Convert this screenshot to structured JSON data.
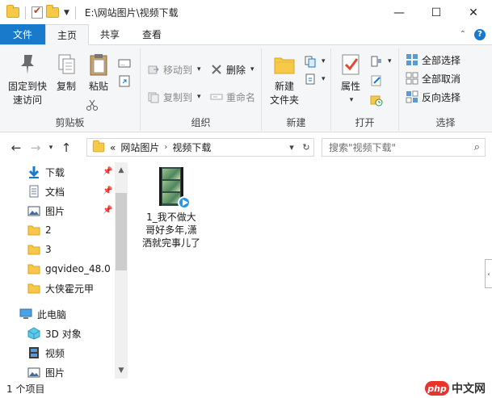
{
  "window": {
    "title": "E:\\网站图片\\视频下载",
    "buttons": {
      "minimize": "—",
      "maximize": "☐",
      "close": "✕"
    }
  },
  "ribbon_tabs": [
    {
      "label": "文件"
    },
    {
      "label": "主页"
    },
    {
      "label": "共享"
    },
    {
      "label": "查看"
    }
  ],
  "ribbon": {
    "clipboard": {
      "group_label": "剪贴板",
      "pin_label_line1": "固定到快",
      "pin_label_line2": "速访问",
      "copy_label": "复制",
      "paste_label": "粘贴"
    },
    "organize": {
      "group_label": "组织",
      "move_to": "移动到",
      "copy_to": "复制到",
      "delete": "删除",
      "rename": "重命名"
    },
    "new": {
      "group_label": "新建",
      "new_folder_line1": "新建",
      "new_folder_line2": "文件夹"
    },
    "open": {
      "group_label": "打开",
      "properties": "属性"
    },
    "select": {
      "group_label": "选择",
      "select_all": "全部选择",
      "select_none": "全部取消",
      "invert": "反向选择"
    }
  },
  "address": {
    "overflow": "«",
    "crumbs": [
      "网站图片",
      "视频下载"
    ],
    "search_placeholder": "搜索\"视频下载\""
  },
  "nav_pane": {
    "quick_access": [
      {
        "label": "下载",
        "icon": "download-icon",
        "pinned": true
      },
      {
        "label": "文档",
        "icon": "document-icon",
        "pinned": true
      },
      {
        "label": "图片",
        "icon": "pictures-icon",
        "pinned": true
      },
      {
        "label": "2",
        "icon": "folder-icon",
        "pinned": false
      },
      {
        "label": "3",
        "icon": "folder-icon",
        "pinned": false
      },
      {
        "label": "gqvideo_48.0",
        "icon": "folder-icon",
        "pinned": false
      },
      {
        "label": "大侠霍元甲",
        "icon": "folder-icon",
        "pinned": false
      }
    ],
    "this_pc": {
      "label": "此电脑",
      "icon": "computer-icon"
    },
    "pc_items": [
      {
        "label": "3D 对象",
        "icon": "3d-objects-icon"
      },
      {
        "label": "视频",
        "icon": "video-icon"
      },
      {
        "label": "图片",
        "icon": "pictures-icon"
      }
    ]
  },
  "files": [
    {
      "name": "1_我不做大哥好多年,潇洒就完事儿了",
      "icon": "video-file-icon"
    }
  ],
  "status": {
    "item_count": "1 个项目"
  },
  "watermark": {
    "logo": "php",
    "text": "中文网"
  },
  "colors": {
    "accent": "#1979ca",
    "folder": "#f7c948",
    "ribbon_bg": "#f5f6f7"
  }
}
